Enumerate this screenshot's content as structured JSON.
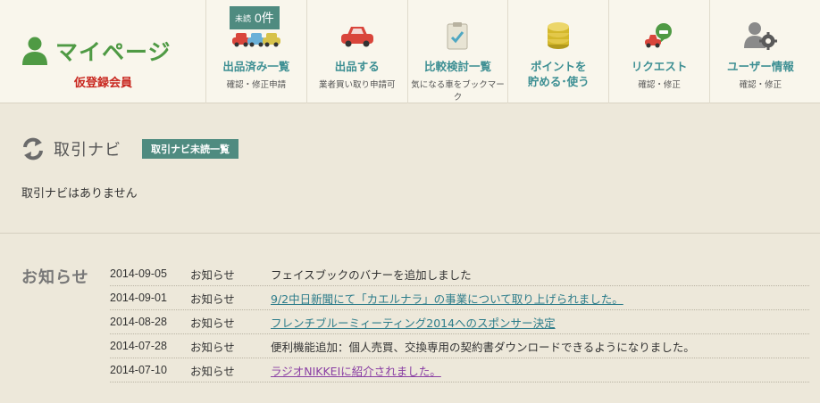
{
  "header": {
    "mypage_title": "マイページ",
    "member_status": "仮登録会員"
  },
  "nav": {
    "items": [
      {
        "label": "出品済み一覧",
        "sub": "確認・修正申請",
        "icon": "cars-icon",
        "badge": {
          "small": "未読",
          "count": "0件"
        }
      },
      {
        "label": "出品する",
        "sub": "業者買い取り申請可",
        "icon": "red-car-icon"
      },
      {
        "label": "比較検討一覧",
        "sub": "気になる車をブックマーク",
        "icon": "clipboard-check-icon"
      },
      {
        "label1": "ポイントを",
        "label2": "貯める･使う",
        "icon": "coins-icon"
      },
      {
        "label": "リクエスト",
        "sub": "確認・修正",
        "icon": "request-car-icon"
      },
      {
        "label": "ユーザー情報",
        "sub": "確認・修正",
        "icon": "user-gear-icon"
      }
    ]
  },
  "torihiki": {
    "title": "取引ナビ",
    "unread_button": "取引ナビ未読一覧",
    "empty_message": "取引ナビはありません"
  },
  "news": {
    "title": "お知らせ",
    "items": [
      {
        "date": "2014-09-05",
        "category": "お知らせ",
        "text": "フェイスブックのバナーを追加しました",
        "link": false
      },
      {
        "date": "2014-09-01",
        "category": "お知らせ",
        "text": "9/2中日新聞にて「カエルナラ」の事業について取り上げられました。",
        "link": true
      },
      {
        "date": "2014-08-28",
        "category": "お知らせ",
        "text": "フレンチブルーミィーティング2014へのスポンサー決定",
        "link": true
      },
      {
        "date": "2014-07-28",
        "category": "お知らせ",
        "text": "便利機能追加：個人売買、交換専用の契約書ダウンロードできるようになりました。",
        "link": false
      },
      {
        "date": "2014-07-10",
        "category": "お知らせ",
        "text": "ラジオNIKKEIに紹介されました。",
        "link": true
      }
    ]
  },
  "colors": {
    "accent_green": "#4f9a44",
    "nav_teal": "#3d8f93",
    "member_red": "#c8261e",
    "badge_bg": "#4f8b80"
  }
}
